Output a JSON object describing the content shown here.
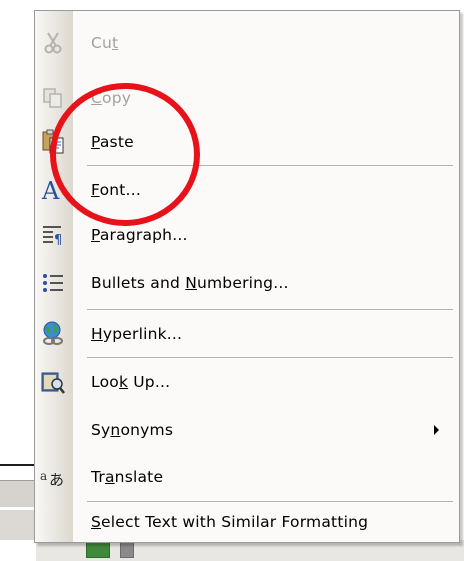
{
  "menu": {
    "items": [
      {
        "key": "cut",
        "pre": "Cu",
        "ul": "t",
        "post": "",
        "disabled": true,
        "icon": "scissors-icon"
      },
      {
        "key": "copy",
        "pre": "",
        "ul": "C",
        "post": "opy",
        "disabled": true,
        "icon": "copy-icon"
      },
      {
        "key": "paste",
        "pre": "",
        "ul": "P",
        "post": "aste",
        "disabled": false,
        "icon": "paste-icon"
      },
      {
        "key": "font",
        "pre": "",
        "ul": "F",
        "post": "ont...",
        "disabled": false,
        "icon": "font-icon"
      },
      {
        "key": "paragraph",
        "pre": "",
        "ul": "P",
        "post": "aragraph...",
        "disabled": false,
        "icon": "paragraph-icon"
      },
      {
        "key": "bullets",
        "pre": "Bullets and ",
        "ul": "N",
        "post": "umbering...",
        "disabled": false,
        "icon": "bullets-icon"
      },
      {
        "key": "hyperlink",
        "pre": "",
        "ul": "H",
        "post": "yperlink...",
        "disabled": false,
        "icon": "hyperlink-icon"
      },
      {
        "key": "lookup",
        "pre": "Loo",
        "ul": "k",
        "post": " Up...",
        "disabled": false,
        "icon": "lookup-icon"
      },
      {
        "key": "synonyms",
        "pre": "Sy",
        "ul": "n",
        "post": "onyms",
        "disabled": false,
        "icon": "",
        "submenu": true
      },
      {
        "key": "translate",
        "pre": "Tr",
        "ul": "a",
        "post": "nslate",
        "disabled": false,
        "icon": "translate-icon"
      },
      {
        "key": "selectsimilar",
        "pre": "",
        "ul": "S",
        "post": "elect Text with Similar Formatting",
        "disabled": false,
        "icon": ""
      }
    ]
  },
  "annotation": {
    "color": "#e8121a",
    "target": "paste"
  }
}
